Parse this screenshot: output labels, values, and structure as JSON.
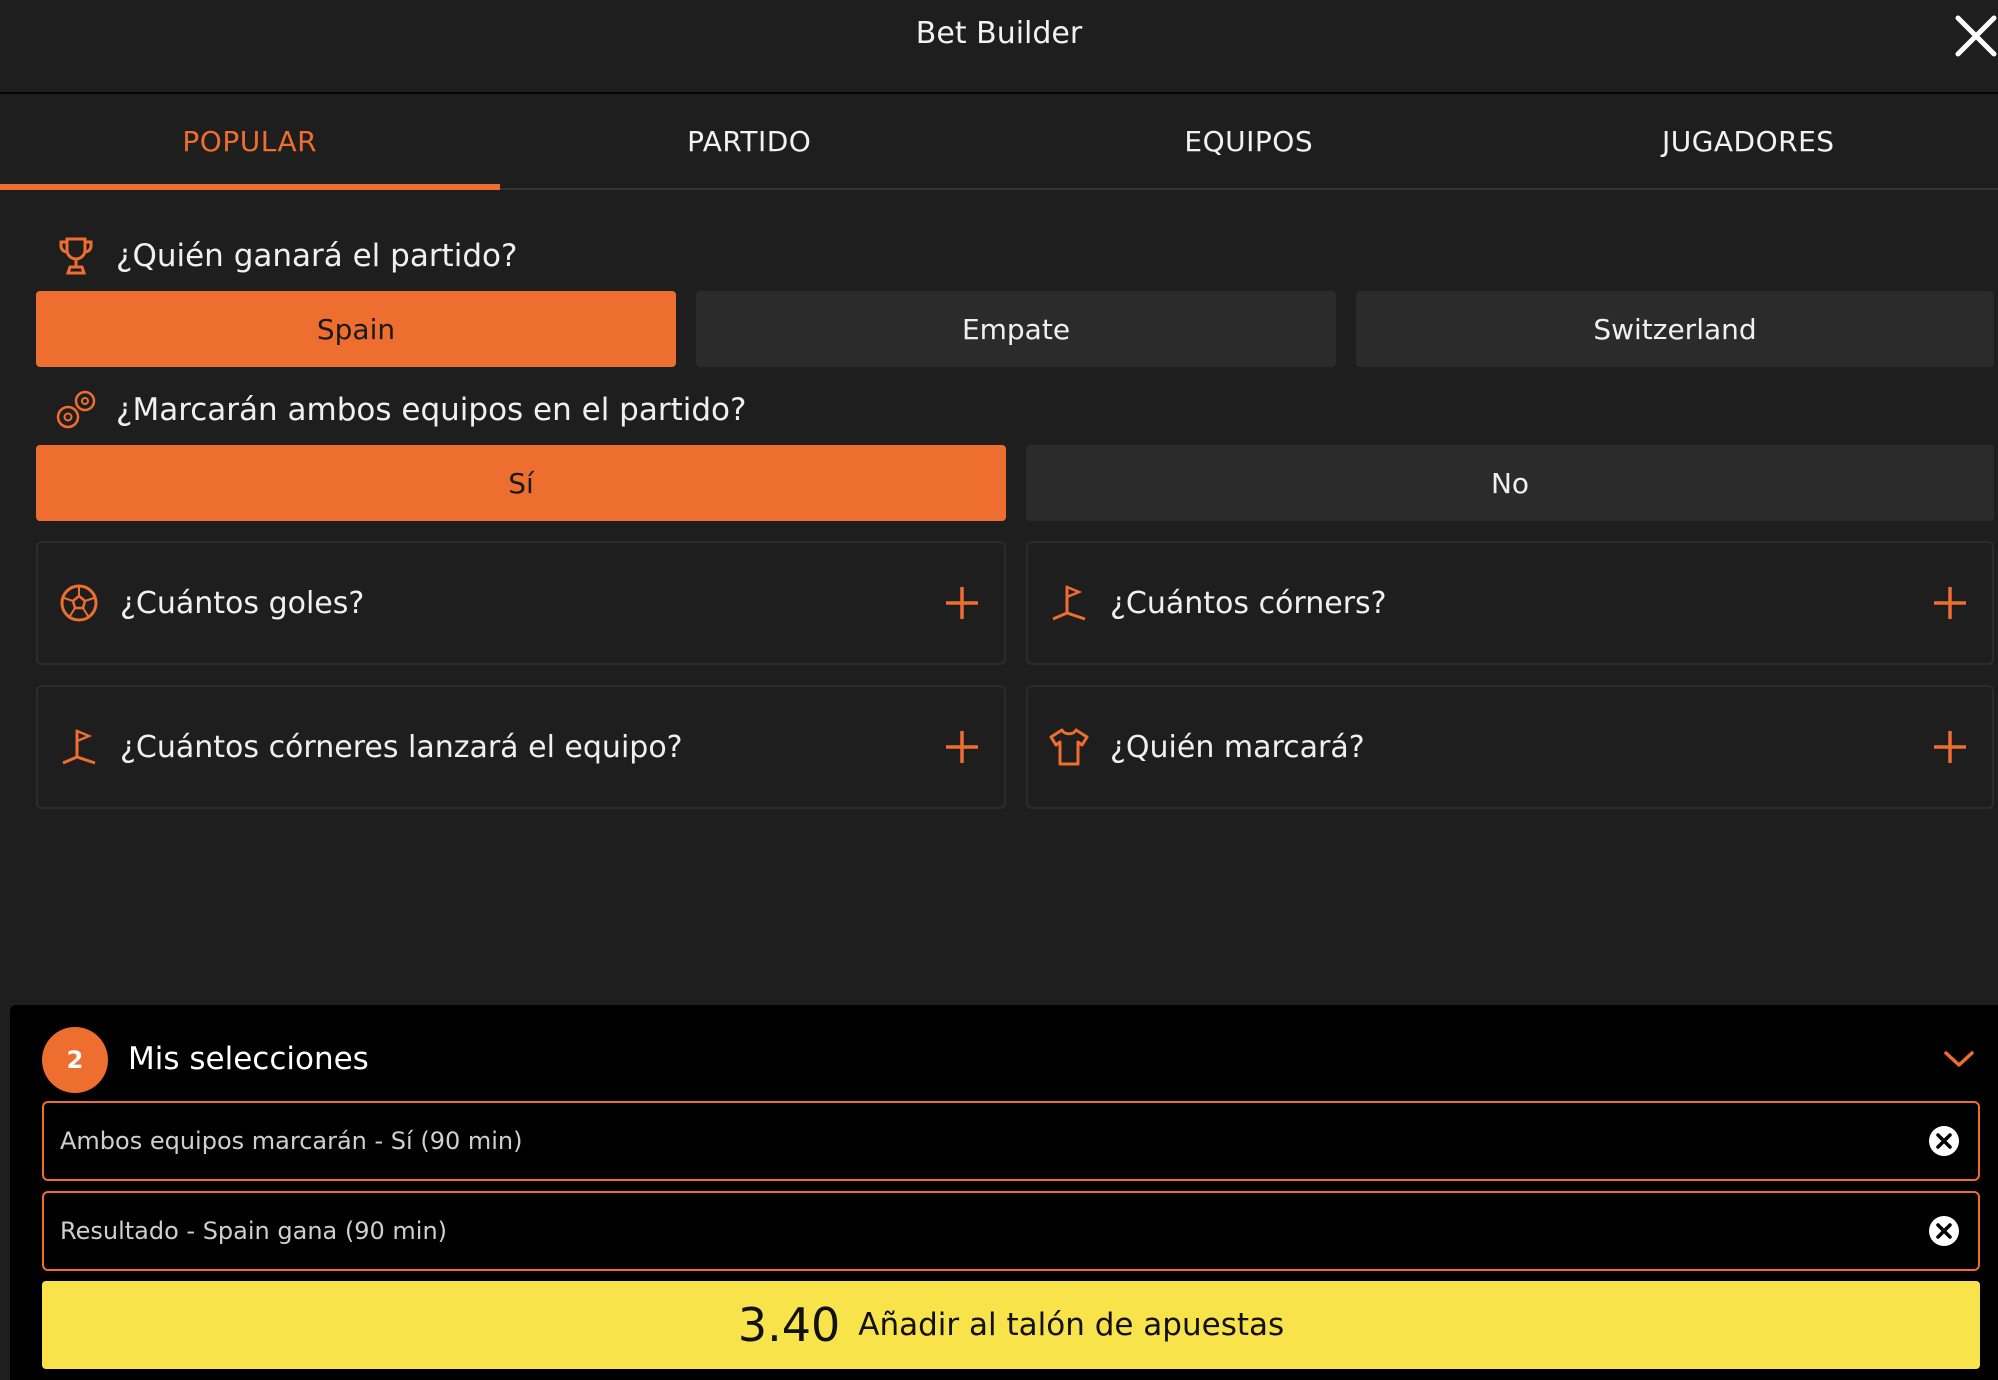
{
  "header": {
    "title": "Bet Builder"
  },
  "tabs": [
    {
      "label": "POPULAR",
      "active": true
    },
    {
      "label": "PARTIDO",
      "active": false
    },
    {
      "label": "EQUIPOS",
      "active": false
    },
    {
      "label": "JUGADORES",
      "active": false
    }
  ],
  "questions": {
    "winner": {
      "title": "¿Quién ganará el partido?",
      "icon": "trophy-icon",
      "options": [
        "Spain",
        "Empate",
        "Switzerland"
      ],
      "selected": "Spain"
    },
    "btts": {
      "title": "¿Marcarán ambos equipos en el partido?",
      "icon": "two-balls-icon",
      "options": [
        "Sí",
        "No"
      ],
      "selected": "Sí"
    }
  },
  "cards": [
    {
      "label": "¿Cuántos goles?",
      "icon": "football-icon"
    },
    {
      "label": "¿Cuántos córners?",
      "icon": "corner-flag-icon"
    },
    {
      "label": "¿Cuántos córneres lanzará el equipo?",
      "icon": "corner-flag-icon"
    },
    {
      "label": "¿Quién marcará?",
      "icon": "shirt-icon"
    }
  ],
  "selections": {
    "count": "2",
    "title": "Mis selecciones",
    "items": [
      "Ambos equipos marcarán - Sí (90 min)",
      "Resultado - Spain gana (90 min)"
    ]
  },
  "cta": {
    "odds": "3.40",
    "label": "Añadir al talón de apuestas"
  },
  "colors": {
    "accent": "#ee6e2f",
    "cta": "#f8e34b",
    "background": "#1e1e1e",
    "button": "#2b2b2b"
  }
}
